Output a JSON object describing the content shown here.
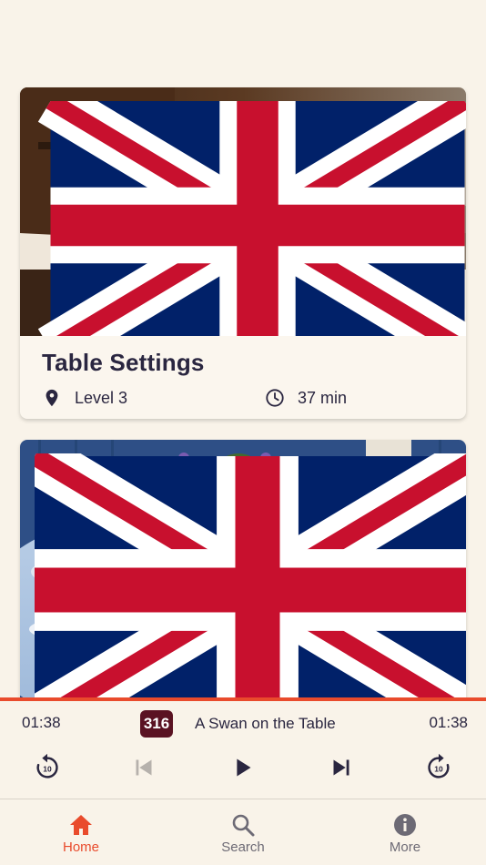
{
  "tours": [
    {
      "title": "Table Settings",
      "level": "Level 3",
      "duration": "37 min",
      "language_flag": "uk-flag-icon"
    },
    {
      "title": "",
      "language_flag": "uk-flag-icon"
    }
  ],
  "player": {
    "elapsed": "01:38",
    "remaining": "01:38",
    "track_number": "316",
    "track_title": "A Swan on the Table",
    "accent_color": "#e94b2c",
    "badge_color": "#5a1222"
  },
  "controls": [
    "rewind-10-icon",
    "previous-track-icon",
    "play-icon",
    "next-track-icon",
    "forward-10-icon"
  ],
  "tabs": [
    {
      "label": "Home",
      "icon": "home-icon",
      "active": true
    },
    {
      "label": "Search",
      "icon": "search-icon",
      "active": false
    },
    {
      "label": "More",
      "icon": "info-icon",
      "active": false
    }
  ]
}
